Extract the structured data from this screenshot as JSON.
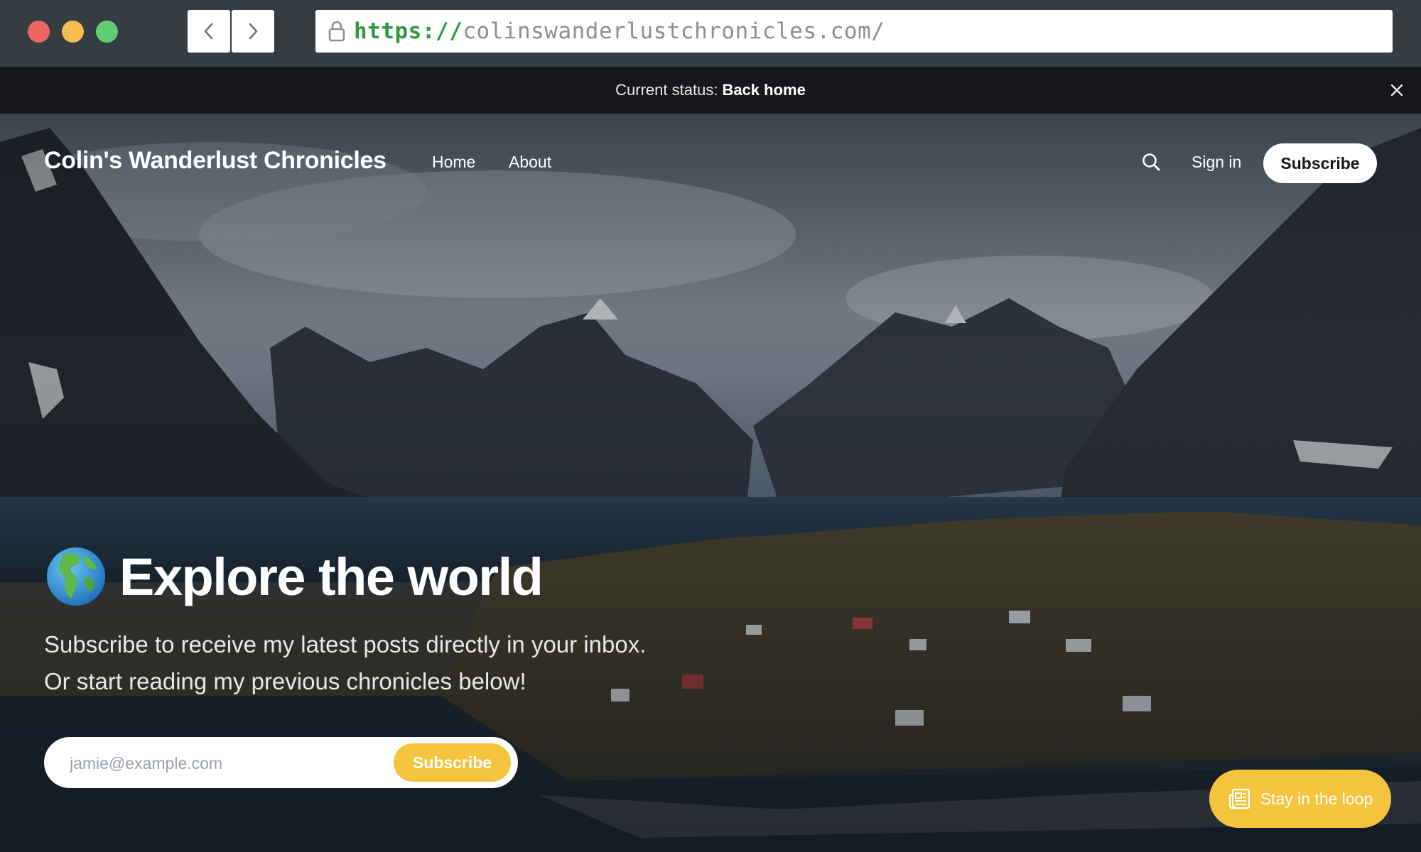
{
  "browser": {
    "url_scheme": "https://",
    "url_host": "colinswanderlustchronicles.com/",
    "icons": {
      "back": "chevron-left-icon",
      "forward": "chevron-right-icon",
      "lock": "lock-icon"
    },
    "colors": {
      "close": "#ee6363",
      "minimize": "#f4bd50",
      "maximize": "#61cf71"
    }
  },
  "announcement": {
    "label": "Current status:",
    "value": "Back home",
    "close_icon": "close-icon"
  },
  "site": {
    "title": "Colin's Wanderlust Chronicles",
    "nav": {
      "home": "Home",
      "about": "About"
    },
    "search_icon": "search-icon",
    "signin": "Sign in",
    "subscribe": "Subscribe",
    "accent": "#f4c43f"
  },
  "hero": {
    "emoji_icon": "globe-icon",
    "heading": "Explore the world",
    "subtitle_line1": "Subscribe to receive my latest posts directly in your inbox.",
    "subtitle_line2": "Or start reading my previous chronicles below!",
    "form": {
      "placeholder": "jamie@example.com",
      "button": "Subscribe"
    }
  },
  "portal": {
    "label": "Stay in the loop",
    "icon": "newsletter-icon"
  }
}
